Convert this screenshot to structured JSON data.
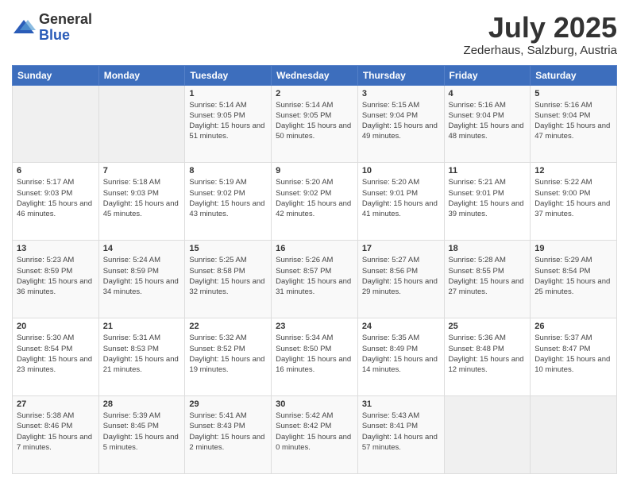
{
  "logo": {
    "general": "General",
    "blue": "Blue"
  },
  "header": {
    "month": "July 2025",
    "location": "Zederhaus, Salzburg, Austria"
  },
  "weekdays": [
    "Sunday",
    "Monday",
    "Tuesday",
    "Wednesday",
    "Thursday",
    "Friday",
    "Saturday"
  ],
  "weeks": [
    [
      {
        "day": "",
        "sunrise": "",
        "sunset": "",
        "daylight": ""
      },
      {
        "day": "",
        "sunrise": "",
        "sunset": "",
        "daylight": ""
      },
      {
        "day": "1",
        "sunrise": "Sunrise: 5:14 AM",
        "sunset": "Sunset: 9:05 PM",
        "daylight": "Daylight: 15 hours and 51 minutes."
      },
      {
        "day": "2",
        "sunrise": "Sunrise: 5:14 AM",
        "sunset": "Sunset: 9:05 PM",
        "daylight": "Daylight: 15 hours and 50 minutes."
      },
      {
        "day": "3",
        "sunrise": "Sunrise: 5:15 AM",
        "sunset": "Sunset: 9:04 PM",
        "daylight": "Daylight: 15 hours and 49 minutes."
      },
      {
        "day": "4",
        "sunrise": "Sunrise: 5:16 AM",
        "sunset": "Sunset: 9:04 PM",
        "daylight": "Daylight: 15 hours and 48 minutes."
      },
      {
        "day": "5",
        "sunrise": "Sunrise: 5:16 AM",
        "sunset": "Sunset: 9:04 PM",
        "daylight": "Daylight: 15 hours and 47 minutes."
      }
    ],
    [
      {
        "day": "6",
        "sunrise": "Sunrise: 5:17 AM",
        "sunset": "Sunset: 9:03 PM",
        "daylight": "Daylight: 15 hours and 46 minutes."
      },
      {
        "day": "7",
        "sunrise": "Sunrise: 5:18 AM",
        "sunset": "Sunset: 9:03 PM",
        "daylight": "Daylight: 15 hours and 45 minutes."
      },
      {
        "day": "8",
        "sunrise": "Sunrise: 5:19 AM",
        "sunset": "Sunset: 9:02 PM",
        "daylight": "Daylight: 15 hours and 43 minutes."
      },
      {
        "day": "9",
        "sunrise": "Sunrise: 5:20 AM",
        "sunset": "Sunset: 9:02 PM",
        "daylight": "Daylight: 15 hours and 42 minutes."
      },
      {
        "day": "10",
        "sunrise": "Sunrise: 5:20 AM",
        "sunset": "Sunset: 9:01 PM",
        "daylight": "Daylight: 15 hours and 41 minutes."
      },
      {
        "day": "11",
        "sunrise": "Sunrise: 5:21 AM",
        "sunset": "Sunset: 9:01 PM",
        "daylight": "Daylight: 15 hours and 39 minutes."
      },
      {
        "day": "12",
        "sunrise": "Sunrise: 5:22 AM",
        "sunset": "Sunset: 9:00 PM",
        "daylight": "Daylight: 15 hours and 37 minutes."
      }
    ],
    [
      {
        "day": "13",
        "sunrise": "Sunrise: 5:23 AM",
        "sunset": "Sunset: 8:59 PM",
        "daylight": "Daylight: 15 hours and 36 minutes."
      },
      {
        "day": "14",
        "sunrise": "Sunrise: 5:24 AM",
        "sunset": "Sunset: 8:59 PM",
        "daylight": "Daylight: 15 hours and 34 minutes."
      },
      {
        "day": "15",
        "sunrise": "Sunrise: 5:25 AM",
        "sunset": "Sunset: 8:58 PM",
        "daylight": "Daylight: 15 hours and 32 minutes."
      },
      {
        "day": "16",
        "sunrise": "Sunrise: 5:26 AM",
        "sunset": "Sunset: 8:57 PM",
        "daylight": "Daylight: 15 hours and 31 minutes."
      },
      {
        "day": "17",
        "sunrise": "Sunrise: 5:27 AM",
        "sunset": "Sunset: 8:56 PM",
        "daylight": "Daylight: 15 hours and 29 minutes."
      },
      {
        "day": "18",
        "sunrise": "Sunrise: 5:28 AM",
        "sunset": "Sunset: 8:55 PM",
        "daylight": "Daylight: 15 hours and 27 minutes."
      },
      {
        "day": "19",
        "sunrise": "Sunrise: 5:29 AM",
        "sunset": "Sunset: 8:54 PM",
        "daylight": "Daylight: 15 hours and 25 minutes."
      }
    ],
    [
      {
        "day": "20",
        "sunrise": "Sunrise: 5:30 AM",
        "sunset": "Sunset: 8:54 PM",
        "daylight": "Daylight: 15 hours and 23 minutes."
      },
      {
        "day": "21",
        "sunrise": "Sunrise: 5:31 AM",
        "sunset": "Sunset: 8:53 PM",
        "daylight": "Daylight: 15 hours and 21 minutes."
      },
      {
        "day": "22",
        "sunrise": "Sunrise: 5:32 AM",
        "sunset": "Sunset: 8:52 PM",
        "daylight": "Daylight: 15 hours and 19 minutes."
      },
      {
        "day": "23",
        "sunrise": "Sunrise: 5:34 AM",
        "sunset": "Sunset: 8:50 PM",
        "daylight": "Daylight: 15 hours and 16 minutes."
      },
      {
        "day": "24",
        "sunrise": "Sunrise: 5:35 AM",
        "sunset": "Sunset: 8:49 PM",
        "daylight": "Daylight: 15 hours and 14 minutes."
      },
      {
        "day": "25",
        "sunrise": "Sunrise: 5:36 AM",
        "sunset": "Sunset: 8:48 PM",
        "daylight": "Daylight: 15 hours and 12 minutes."
      },
      {
        "day": "26",
        "sunrise": "Sunrise: 5:37 AM",
        "sunset": "Sunset: 8:47 PM",
        "daylight": "Daylight: 15 hours and 10 minutes."
      }
    ],
    [
      {
        "day": "27",
        "sunrise": "Sunrise: 5:38 AM",
        "sunset": "Sunset: 8:46 PM",
        "daylight": "Daylight: 15 hours and 7 minutes."
      },
      {
        "day": "28",
        "sunrise": "Sunrise: 5:39 AM",
        "sunset": "Sunset: 8:45 PM",
        "daylight": "Daylight: 15 hours and 5 minutes."
      },
      {
        "day": "29",
        "sunrise": "Sunrise: 5:41 AM",
        "sunset": "Sunset: 8:43 PM",
        "daylight": "Daylight: 15 hours and 2 minutes."
      },
      {
        "day": "30",
        "sunrise": "Sunrise: 5:42 AM",
        "sunset": "Sunset: 8:42 PM",
        "daylight": "Daylight: 15 hours and 0 minutes."
      },
      {
        "day": "31",
        "sunrise": "Sunrise: 5:43 AM",
        "sunset": "Sunset: 8:41 PM",
        "daylight": "Daylight: 14 hours and 57 minutes."
      },
      {
        "day": "",
        "sunrise": "",
        "sunset": "",
        "daylight": ""
      },
      {
        "day": "",
        "sunrise": "",
        "sunset": "",
        "daylight": ""
      }
    ]
  ]
}
